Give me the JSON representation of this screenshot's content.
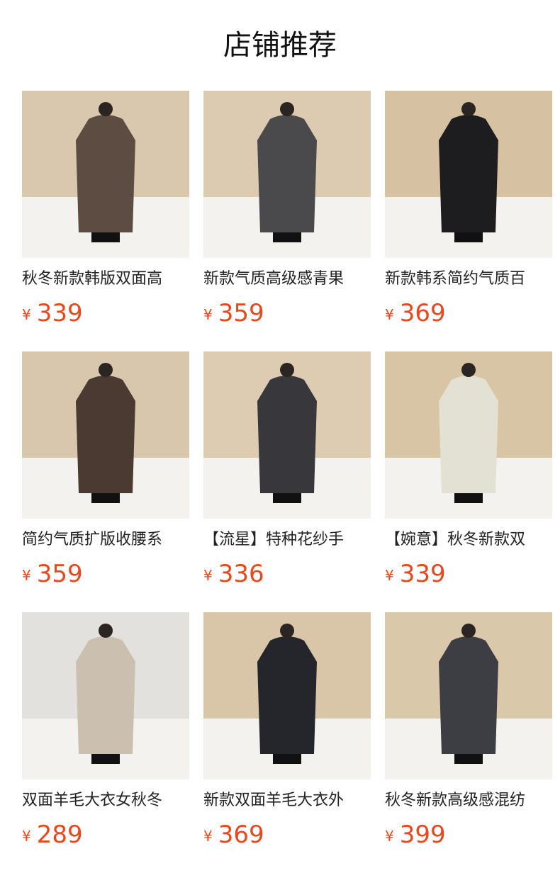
{
  "header": {
    "title": "店铺推荐"
  },
  "currency": "¥",
  "accent": "#e8481d",
  "products": [
    {
      "name": "秋冬新款韩版双面高",
      "price": "339",
      "coat": "#5c4c42",
      "bg": "#e7dccb",
      "wall": "#d9c8ae"
    },
    {
      "name": "新款气质高级感青果",
      "price": "359",
      "coat": "#4a4a4c",
      "bg": "#e8ddcb",
      "wall": "#dccbb0"
    },
    {
      "name": "新款韩系简约气质百",
      "price": "369",
      "coat": "#1d1d20",
      "bg": "#e6d9c4",
      "wall": "#d6c2a2"
    },
    {
      "name": "简约气质扩版收腰系",
      "price": "359",
      "coat": "#4a3a31",
      "bg": "#e5dacb",
      "wall": "#d8c7ad"
    },
    {
      "name": "【流星】特种花纱手",
      "price": "336",
      "coat": "#38383c",
      "bg": "#e9dfcf",
      "wall": "#ddccb2"
    },
    {
      "name": "【婉意】秋冬新款双",
      "price": "339",
      "coat": "#e2e1d3",
      "bg": "#e6dbc8",
      "wall": "#d8c5a6"
    },
    {
      "name": "双面羊毛大衣女秋冬",
      "price": "289",
      "coat": "#cbbfb0",
      "bg": "#f1efec",
      "wall": "#e3e1de"
    },
    {
      "name": "新款双面羊毛大衣外",
      "price": "369",
      "coat": "#24262b",
      "bg": "#e6dbc8",
      "wall": "#d9c6a8"
    },
    {
      "name": "秋冬新款高级感混纺",
      "price": "399",
      "coat": "#3d3e44",
      "bg": "#e7dcc9",
      "wall": "#dac8aa"
    }
  ]
}
